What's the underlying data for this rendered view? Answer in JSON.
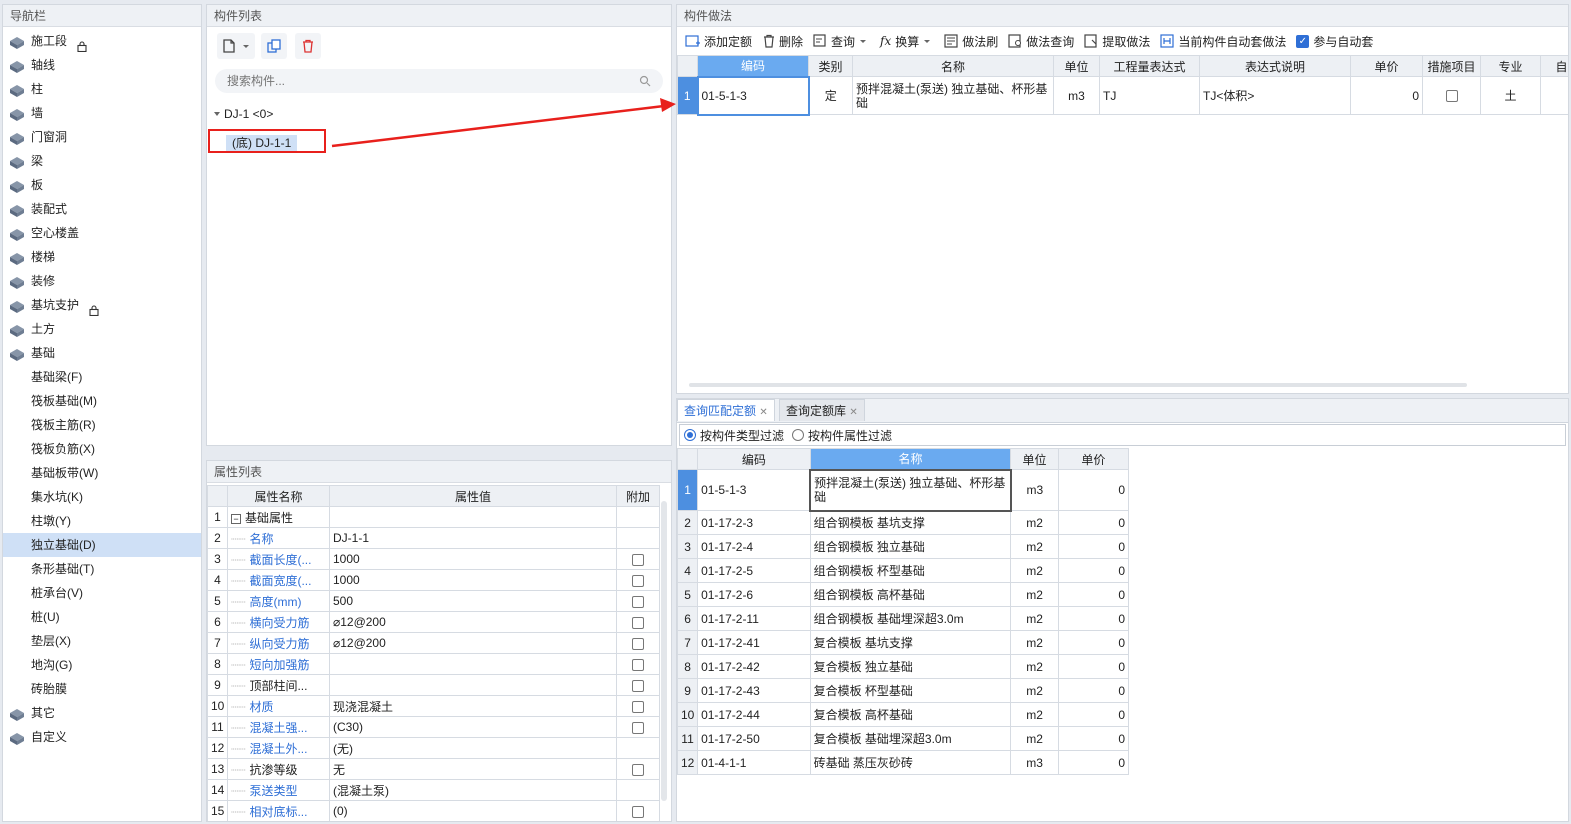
{
  "nav": {
    "title": "导航栏",
    "items": [
      {
        "label": "施工段",
        "icon": "segment-icon",
        "lock": true,
        "sub": false
      },
      {
        "label": "轴线",
        "icon": "grid-axis-icon",
        "sub": false
      },
      {
        "label": "柱",
        "icon": "column-icon",
        "sub": false
      },
      {
        "label": "墙",
        "icon": "wall-icon",
        "sub": false
      },
      {
        "label": "门窗洞",
        "icon": "door-window-icon",
        "sub": false
      },
      {
        "label": "梁",
        "icon": "beam-icon",
        "sub": false
      },
      {
        "label": "板",
        "icon": "slab-icon",
        "sub": false
      },
      {
        "label": "装配式",
        "icon": "prefab-icon",
        "sub": false
      },
      {
        "label": "空心楼盖",
        "icon": "hollow-floor-icon",
        "sub": false
      },
      {
        "label": "楼梯",
        "icon": "stairs-icon",
        "sub": false
      },
      {
        "label": "装修",
        "icon": "decoration-icon",
        "sub": false
      },
      {
        "label": "基坑支护",
        "icon": "pit-support-icon",
        "lock": true,
        "sub": false
      },
      {
        "label": "土方",
        "icon": "earthwork-icon",
        "sub": false
      },
      {
        "label": "基础",
        "icon": "foundation-icon",
        "sub": false
      },
      {
        "label": "基础梁(F)",
        "sub": true
      },
      {
        "label": "筏板基础(M)",
        "sub": true
      },
      {
        "label": "筏板主筋(R)",
        "sub": true
      },
      {
        "label": "筏板负筋(X)",
        "sub": true
      },
      {
        "label": "基础板带(W)",
        "sub": true
      },
      {
        "label": "集水坑(K)",
        "sub": true
      },
      {
        "label": "柱墩(Y)",
        "sub": true
      },
      {
        "label": "独立基础(D)",
        "sub": true,
        "selected": true
      },
      {
        "label": "条形基础(T)",
        "sub": true
      },
      {
        "label": "桩承台(V)",
        "sub": true
      },
      {
        "label": "桩(U)",
        "sub": true
      },
      {
        "label": "垫层(X)",
        "sub": true
      },
      {
        "label": "地沟(G)",
        "sub": true
      },
      {
        "label": "砖胎膜",
        "sub": true
      },
      {
        "label": "其它",
        "icon": "other-icon",
        "sub": false
      },
      {
        "label": "自定义",
        "icon": "custom-icon",
        "sub": false
      }
    ]
  },
  "component_list": {
    "title": "构件列表",
    "search_placeholder": "搜索构件...",
    "parent": "DJ-1 <0>",
    "child": "(底) DJ-1-1"
  },
  "properties": {
    "title": "属性列表",
    "headers": [
      "属性名称",
      "属性值",
      "附加"
    ],
    "rows": [
      {
        "n": "1",
        "name": "基础属性",
        "value": "",
        "check": false,
        "group": true
      },
      {
        "n": "2",
        "name": "名称",
        "value": "DJ-1-1",
        "check": false,
        "blue": true
      },
      {
        "n": "3",
        "name": "截面长度(...",
        "value": "1000",
        "check": true,
        "blue": true
      },
      {
        "n": "4",
        "name": "截面宽度(...",
        "value": "1000",
        "check": true,
        "blue": true
      },
      {
        "n": "5",
        "name": "高度(mm)",
        "value": "500",
        "check": true,
        "blue": true
      },
      {
        "n": "6",
        "name": "横向受力筋",
        "value": "⌀12@200",
        "check": true,
        "blue": true
      },
      {
        "n": "7",
        "name": "纵向受力筋",
        "value": "⌀12@200",
        "check": true,
        "blue": true
      },
      {
        "n": "8",
        "name": "短向加强筋",
        "value": "",
        "check": true,
        "blue": true
      },
      {
        "n": "9",
        "name": "顶部柱间...",
        "value": "",
        "check": true,
        "blue": false
      },
      {
        "n": "10",
        "name": "材质",
        "value": "现浇混凝土",
        "check": true,
        "blue": true
      },
      {
        "n": "11",
        "name": "混凝土强...",
        "value": "(C30)",
        "check": true,
        "blue": true
      },
      {
        "n": "12",
        "name": "混凝土外...",
        "value": "(无)",
        "check": false,
        "blue": true
      },
      {
        "n": "13",
        "name": "抗渗等级",
        "value": "无",
        "check": true,
        "blue": false
      },
      {
        "n": "14",
        "name": "泵送类型",
        "value": "(混凝土泵)",
        "check": false,
        "blue": true
      },
      {
        "n": "15",
        "name": "相对底标...",
        "value": "(0)",
        "check": true,
        "blue": true
      }
    ]
  },
  "method": {
    "title": "构件做法",
    "toolbar": {
      "add": "添加定额",
      "delete": "删除",
      "query": "查询",
      "convert": "换算",
      "brush": "做法刷",
      "method_query": "做法查询",
      "extract": "提取做法",
      "auto_set": "当前构件自动套做法",
      "participate": "参与自动套"
    },
    "headers": [
      "编码",
      "类别",
      "名称",
      "单位",
      "工程量表达式",
      "表达式说明",
      "单价",
      "措施项目",
      "专业",
      "自"
    ],
    "rows": [
      {
        "n": "1",
        "code": "01-5-1-3",
        "type": "定",
        "name": "预拌混凝土(泵送) 独立基础、杯形基础",
        "unit": "m3",
        "expr": "TJ",
        "desc": "TJ<体积>",
        "price": "0",
        "major": "土"
      }
    ]
  },
  "query": {
    "tab1": "查询匹配定额",
    "tab2": "查询定额库",
    "radio1": "按构件类型过滤",
    "radio2": "按构件属性过滤",
    "headers": [
      "编码",
      "名称",
      "单位",
      "单价"
    ],
    "rows": [
      {
        "n": "1",
        "code": "01-5-1-3",
        "name": "预拌混凝土(泵送) 独立基础、杯形基础",
        "unit": "m3",
        "price": "0"
      },
      {
        "n": "2",
        "code": "01-17-2-3",
        "name": "组合钢模板 基坑支撑",
        "unit": "m2",
        "price": "0"
      },
      {
        "n": "3",
        "code": "01-17-2-4",
        "name": "组合钢模板 独立基础",
        "unit": "m2",
        "price": "0"
      },
      {
        "n": "4",
        "code": "01-17-2-5",
        "name": "组合钢模板 杯型基础",
        "unit": "m2",
        "price": "0"
      },
      {
        "n": "5",
        "code": "01-17-2-6",
        "name": "组合钢模板 高杯基础",
        "unit": "m2",
        "price": "0"
      },
      {
        "n": "6",
        "code": "01-17-2-11",
        "name": "组合钢模板 基础埋深超3.0m",
        "unit": "m2",
        "price": "0"
      },
      {
        "n": "7",
        "code": "01-17-2-41",
        "name": "复合模板 基坑支撑",
        "unit": "m2",
        "price": "0"
      },
      {
        "n": "8",
        "code": "01-17-2-42",
        "name": "复合模板 独立基础",
        "unit": "m2",
        "price": "0"
      },
      {
        "n": "9",
        "code": "01-17-2-43",
        "name": "复合模板 杯型基础",
        "unit": "m2",
        "price": "0"
      },
      {
        "n": "10",
        "code": "01-17-2-44",
        "name": "复合模板 高杯基础",
        "unit": "m2",
        "price": "0"
      },
      {
        "n": "11",
        "code": "01-17-2-50",
        "name": "复合模板 基础埋深超3.0m",
        "unit": "m2",
        "price": "0"
      },
      {
        "n": "12",
        "code": "01-4-1-1",
        "name": "砖基础 蒸压灰砂砖",
        "unit": "m3",
        "price": "0"
      }
    ]
  }
}
